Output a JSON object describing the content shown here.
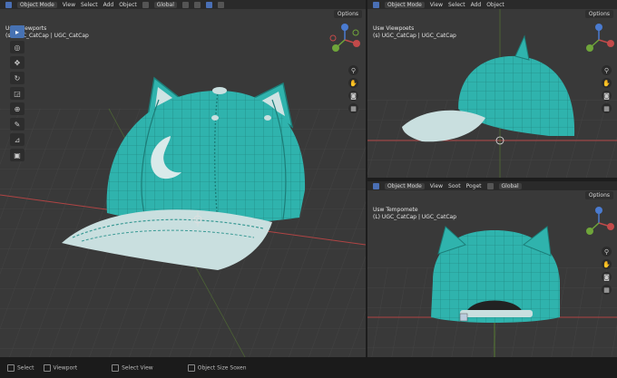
{
  "main": {
    "mode": "Object Mode",
    "menus": [
      "View",
      "Select",
      "Add",
      "Object"
    ],
    "orientation": "Global",
    "options_label": "Options",
    "view_name": "User Viewports",
    "object_name": "(s) UGC_CatCap | UGC_CatCap"
  },
  "top_right": {
    "mode": "Object Mode",
    "menus": [
      "View",
      "Select",
      "Add",
      "Object"
    ],
    "orientation": "Global",
    "options_label": "Options",
    "view_name": "Usw Viewpoets",
    "object_name": "(s) UGC_CatCap | UGC_CatCap"
  },
  "bottom_right": {
    "mode": "Object Mode",
    "menus": [
      "View",
      "Soot",
      "Poget"
    ],
    "orientation": "Global",
    "options_label": "Options",
    "view_name": "Usw Tempomete",
    "object_name": "(L) UGC_CatCap | UGC_CatCap"
  },
  "status_bar": {
    "items": [
      "Select",
      "Viewport",
      "Select View",
      "Object Size Soxen"
    ]
  },
  "colors": {
    "cap_teal": "#2fb3ad",
    "brim_light": "#c9dfdf",
    "accent_blue": "#4772b3",
    "axis_red": "#c24a4a",
    "axis_green": "#6fa53a"
  }
}
